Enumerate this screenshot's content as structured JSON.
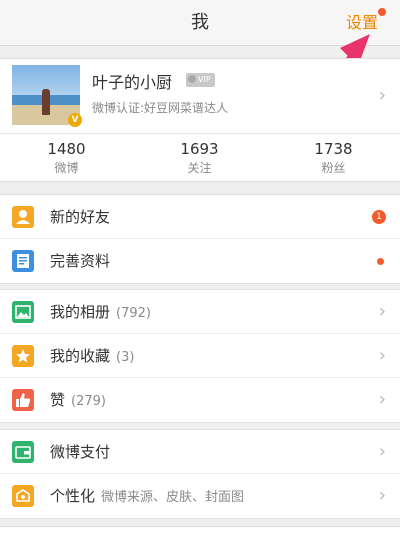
{
  "header": {
    "title": "我",
    "settings_label": "设置"
  },
  "profile": {
    "name": "叶子的小厨",
    "vip_label": "VIP",
    "avatar_badge": "V",
    "verified": "微博认证:好豆网菜谱达人"
  },
  "stats": [
    {
      "value": "1480",
      "label": "微博"
    },
    {
      "value": "1693",
      "label": "关注"
    },
    {
      "value": "1738",
      "label": "粉丝"
    }
  ],
  "groups": [
    {
      "items": [
        {
          "label": "新的好友",
          "icon": "person-icon",
          "color": "#f5a623",
          "badge": "1"
        },
        {
          "label": "完善资料",
          "icon": "profile-form-icon",
          "color": "#3d8fe0",
          "dot": true
        }
      ]
    },
    {
      "items": [
        {
          "label": "我的相册",
          "extra": "(792)",
          "icon": "photo-album-icon",
          "color": "#2fb36e"
        },
        {
          "label": "我的收藏",
          "extra": "(3)",
          "icon": "star-icon",
          "color": "#f5a623"
        },
        {
          "label": "赞",
          "extra": "(279)",
          "icon": "thumbs-up-icon",
          "color": "#f0624a"
        }
      ]
    },
    {
      "items": [
        {
          "label": "微博支付",
          "icon": "wallet-icon",
          "color": "#2fb36e"
        },
        {
          "label": "个性化",
          "extra": "微博来源、皮肤、封面图",
          "icon": "personalize-icon",
          "color": "#f5a623"
        }
      ]
    }
  ]
}
